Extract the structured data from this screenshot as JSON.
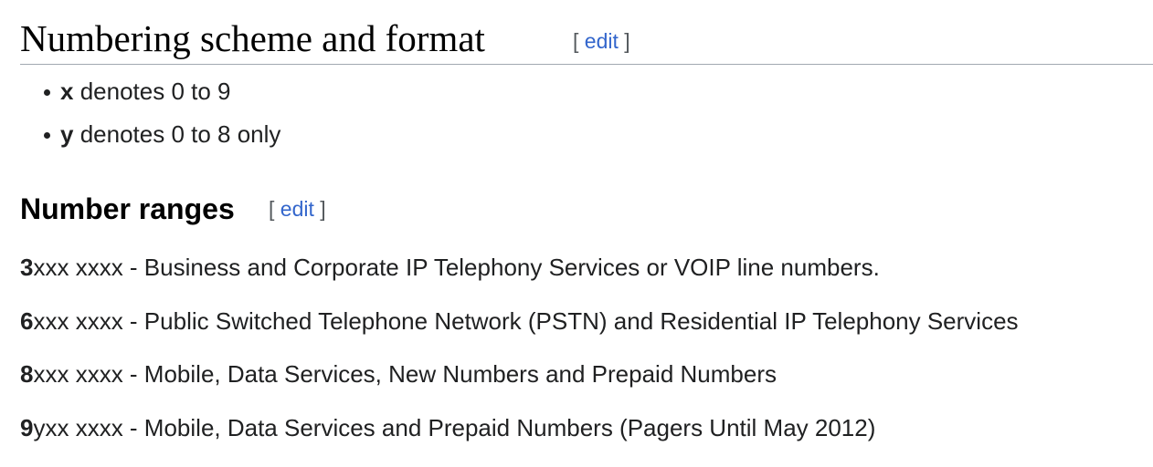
{
  "section": {
    "title": "Numbering scheme and format",
    "edit_open": "[ ",
    "edit_label": "edit",
    "edit_close": " ]"
  },
  "definitions": [
    {
      "symbol": "x",
      "text": " denotes 0 to 9"
    },
    {
      "symbol": "y",
      "text": " denotes 0 to 8 only"
    }
  ],
  "subsection": {
    "title": "Number ranges",
    "edit_open": "[ ",
    "edit_label": "edit",
    "edit_close": " ]"
  },
  "ranges": [
    {
      "prefix": "3",
      "pattern": "xxx xxxx",
      "description": " - Business and Corporate IP Telephony Services or VOIP line numbers."
    },
    {
      "prefix": "6",
      "pattern": "xxx xxxx",
      "description": " - Public Switched Telephone Network (PSTN) and Residential IP Telephony Services"
    },
    {
      "prefix": "8",
      "pattern": "xxx xxxx",
      "description": " - Mobile, Data Services, New Numbers and Prepaid Numbers"
    },
    {
      "prefix": "9",
      "pattern": "yxx xxxx",
      "description": " - Mobile, Data Services and Prepaid Numbers (Pagers Until May 2012)"
    }
  ]
}
